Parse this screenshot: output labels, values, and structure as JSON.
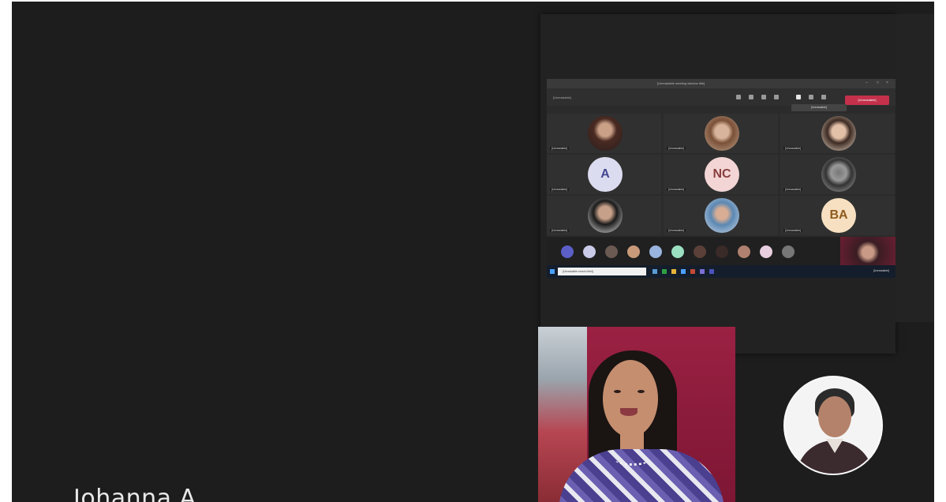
{
  "stage": {
    "speaker_name": "Johanna A."
  },
  "shared_window": {
    "title": "[Unreadable meeting window title]",
    "toolbar_left": "[Unreadable]",
    "leave_label": "[Unreadable]",
    "tooltip": "[Unreadable]",
    "participants": [
      {
        "initials": "",
        "name": "[Unreadable]",
        "avatar": "photo"
      },
      {
        "initials": "",
        "name": "[Unreadable]",
        "avatar": "photo"
      },
      {
        "initials": "",
        "name": "[Unreadable]",
        "avatar": "photo"
      },
      {
        "initials": "A",
        "name": "[Unreadable]",
        "avatar": "initials"
      },
      {
        "initials": "NC",
        "name": "[Unreadable]",
        "avatar": "initials"
      },
      {
        "initials": "",
        "name": "[Unreadable]",
        "avatar": "photo"
      },
      {
        "initials": "",
        "name": "[Unreadable]",
        "avatar": "photo"
      },
      {
        "initials": "",
        "name": "[Unreadable]",
        "avatar": "photo"
      },
      {
        "initials": "BA",
        "name": "[Unreadable]",
        "avatar": "initials"
      }
    ],
    "taskbar_search": "[Unreadable search field]",
    "taskbar_clock": "[Unreadable]"
  },
  "colors": {
    "stage_bg": "#1d1d1d",
    "leave_button": "#c4314b",
    "taskbar": "#141d2b"
  },
  "icons": [
    "windows-start-icon",
    "video-camera-icon",
    "microphone-icon",
    "more-icon",
    "share-screen-icon"
  ]
}
